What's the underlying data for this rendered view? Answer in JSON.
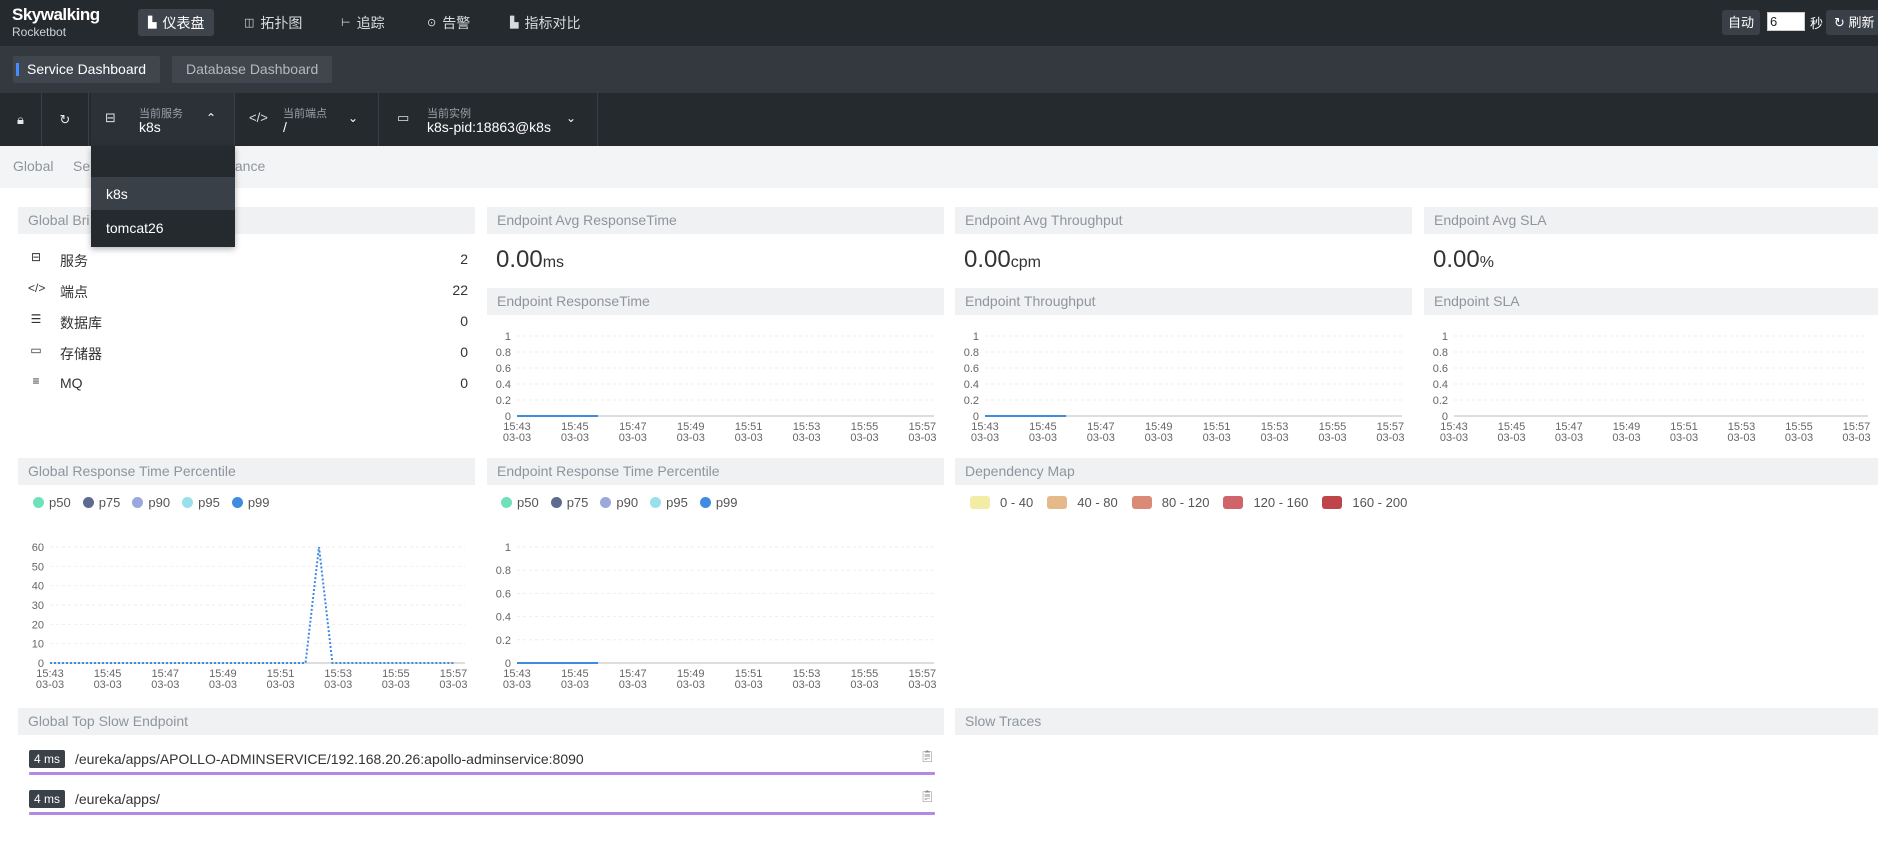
{
  "header": {
    "logo_title": "Skywalking",
    "logo_subtitle": "Rocketbot",
    "nav": [
      {
        "label": "仪表盘",
        "icon": "dashboard-icon",
        "active": true
      },
      {
        "label": "拓扑图",
        "icon": "topology-icon",
        "active": false
      },
      {
        "label": "追踪",
        "icon": "trace-icon",
        "active": false
      },
      {
        "label": "告警",
        "icon": "alarm-icon",
        "active": false
      },
      {
        "label": "指标对比",
        "icon": "compare-icon",
        "active": false
      }
    ],
    "auto_label": "自动",
    "interval_value": "6",
    "seconds_label": "秒",
    "refresh_label": "刷新"
  },
  "dashboard_tabs": [
    "Service Dashboard",
    "Database Dashboard"
  ],
  "selectors": {
    "service": {
      "label": "当前服务",
      "value": "k8s"
    },
    "endpoint": {
      "label": "当前端点",
      "value": "/"
    },
    "instance": {
      "label": "当前实例",
      "value": "k8s-pid:18863@k8s"
    }
  },
  "service_dropdown": {
    "options": [
      "k8s",
      "tomcat26"
    ]
  },
  "breadcrumb": {
    "global": "Global",
    "service_partial": "Se",
    "instance_partial": "tance"
  },
  "global_brief": {
    "title_partial": "Global Bri",
    "rows": [
      {
        "icon": "service-icon",
        "label": "服务",
        "value": "2"
      },
      {
        "icon": "endpoint-icon",
        "label": "端点",
        "value": "22"
      },
      {
        "icon": "database-icon",
        "label": "数据库",
        "value": "0"
      },
      {
        "icon": "storage-icon",
        "label": "存储器",
        "value": "0"
      },
      {
        "icon": "mq-icon",
        "label": "MQ",
        "value": "0"
      }
    ]
  },
  "metrics": {
    "avg_response_time": {
      "title": "Endpoint Avg ResponseTime",
      "value": "0.00",
      "unit": "ms"
    },
    "avg_throughput": {
      "title": "Endpoint Avg Throughput",
      "value": "0.00",
      "unit": "cpm"
    },
    "avg_sla": {
      "title": "Endpoint Avg SLA",
      "value": "0.00",
      "unit": "%"
    }
  },
  "panels": {
    "endpoint_response_time": "Endpoint ResponseTime",
    "endpoint_throughput": "Endpoint Throughput",
    "endpoint_sla": "Endpoint SLA",
    "global_percentile": "Global Response Time Percentile",
    "endpoint_percentile": "Endpoint Response Time Percentile",
    "dependency_map": "Dependency Map",
    "global_top_slow": "Global Top Slow Endpoint",
    "slow_traces": "Slow Traces"
  },
  "percentile_legend": [
    {
      "name": "p50",
      "color": "#6fe0b8"
    },
    {
      "name": "p75",
      "color": "#5d6b8f"
    },
    {
      "name": "p90",
      "color": "#9aa8dc"
    },
    {
      "name": "p95",
      "color": "#99e0ec"
    },
    {
      "name": "p99",
      "color": "#3f8be0"
    }
  ],
  "dependency_legend": [
    {
      "range": "0 - 40",
      "color": "#f3eca4"
    },
    {
      "range": "40 - 80",
      "color": "#e5b98a"
    },
    {
      "range": "80 - 120",
      "color": "#dc8a78"
    },
    {
      "range": "120 - 160",
      "color": "#d0646a"
    },
    {
      "range": "160 - 200",
      "color": "#bf444c"
    }
  ],
  "slow_endpoints": [
    {
      "ms": "4 ms",
      "url": "/eureka/apps/APOLLO-ADMINSERVICE/192.168.20.26:apollo-adminservice:8090"
    },
    {
      "ms": "4 ms",
      "url": "/eureka/apps/"
    }
  ],
  "chart_data": [
    {
      "id": "endpoint_response_time",
      "type": "line",
      "x": [
        "15:43\n03-03",
        "15:45\n03-03",
        "15:47\n03-03",
        "15:49\n03-03",
        "15:51\n03-03",
        "15:53\n03-03",
        "15:55\n03-03",
        "15:57\n03-03"
      ],
      "yticks": [
        0,
        0.2,
        0.4,
        0.6,
        0.8,
        1
      ],
      "ylim": [
        0,
        1
      ],
      "series": [
        {
          "color": "#3f8be0",
          "values": [
            0,
            0,
            0,
            0
          ]
        }
      ]
    },
    {
      "id": "endpoint_throughput",
      "type": "line",
      "x": [
        "15:43\n03-03",
        "15:45\n03-03",
        "15:47\n03-03",
        "15:49\n03-03",
        "15:51\n03-03",
        "15:53\n03-03",
        "15:55\n03-03",
        "15:57\n03-03"
      ],
      "yticks": [
        0,
        0.2,
        0.4,
        0.6,
        0.8,
        1
      ],
      "ylim": [
        0,
        1
      ],
      "series": [
        {
          "color": "#3f8be0",
          "values": [
            0,
            0,
            0,
            0
          ]
        }
      ]
    },
    {
      "id": "endpoint_sla",
      "type": "line",
      "x": [
        "15:43\n03-03",
        "15:45\n03-03",
        "15:47\n03-03",
        "15:49\n03-03",
        "15:51\n03-03",
        "15:53\n03-03",
        "15:55\n03-03",
        "15:57\n03-03"
      ],
      "yticks": [
        0,
        0.2,
        0.4,
        0.6,
        0.8,
        1
      ],
      "ylim": [
        0,
        1
      ],
      "series": []
    },
    {
      "id": "global_percentile",
      "type": "line",
      "x": [
        "15:43\n03-03",
        "15:45\n03-03",
        "15:47\n03-03",
        "15:49\n03-03",
        "15:51\n03-03",
        "15:53\n03-03",
        "15:55\n03-03",
        "15:57\n03-03"
      ],
      "yticks": [
        0,
        10,
        20,
        30,
        40,
        50,
        60
      ],
      "ylim": [
        0,
        60
      ],
      "series": [
        {
          "color": "#3f8be0",
          "values": [
            0,
            0,
            0,
            0,
            0,
            0,
            0,
            0,
            0,
            0,
            0,
            0,
            0,
            0,
            0,
            0,
            0,
            0,
            0,
            0,
            60,
            0,
            0,
            0,
            0,
            0,
            0,
            0,
            0,
            0,
            0
          ]
        }
      ]
    },
    {
      "id": "endpoint_percentile",
      "type": "line",
      "x": [
        "15:43\n03-03",
        "15:45\n03-03",
        "15:47\n03-03",
        "15:49\n03-03",
        "15:51\n03-03",
        "15:53\n03-03",
        "15:55\n03-03",
        "15:57\n03-03"
      ],
      "yticks": [
        0,
        0.2,
        0.4,
        0.6,
        0.8,
        1
      ],
      "ylim": [
        0,
        1
      ],
      "series": [
        {
          "color": "#3f8be0",
          "values": [
            0,
            0,
            0,
            0
          ]
        }
      ]
    }
  ]
}
